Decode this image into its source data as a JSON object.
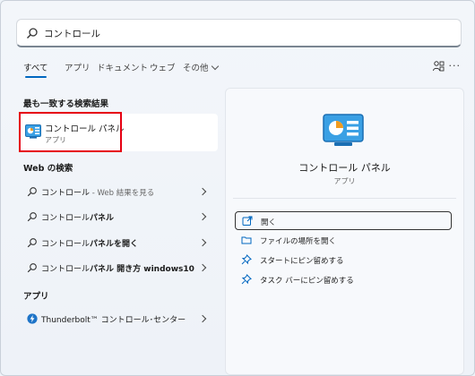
{
  "search": {
    "query": "コントロール"
  },
  "tabs": {
    "all": "すべて",
    "apps": "アプリ",
    "documents": "ドキュメント",
    "web": "ウェブ",
    "other": "その他"
  },
  "best_match": {
    "heading": "最も一致する検索結果",
    "title": "コントロール パネル",
    "subtitle": "アプリ"
  },
  "web_search": {
    "heading": "Web の検索",
    "items": [
      {
        "prefix": "コントロール",
        "bold": "",
        "suffix": " - Web 結果を見る"
      },
      {
        "prefix": "コントロール",
        "bold": "パネル",
        "suffix": ""
      },
      {
        "prefix": "コントロール",
        "bold": "パネルを開く",
        "suffix": ""
      },
      {
        "prefix": "コントロール",
        "bold": "パネル 開き方 windows10",
        "suffix": ""
      }
    ]
  },
  "apps": {
    "heading": "アプリ",
    "items": [
      {
        "label": "Thunderbolt™ コントロール･センター"
      }
    ]
  },
  "details": {
    "title": "コントロール パネル",
    "subtitle": "アプリ",
    "actions": [
      {
        "label": "開く",
        "icon": "open-icon"
      },
      {
        "label": "ファイルの場所を開く",
        "icon": "folder-icon"
      },
      {
        "label": "スタートにピン留めする",
        "icon": "pin-icon"
      },
      {
        "label": "タスク バーにピン留めする",
        "icon": "pin-icon"
      }
    ]
  },
  "colors": {
    "accent": "#0067c0",
    "highlight": "#e60012"
  }
}
